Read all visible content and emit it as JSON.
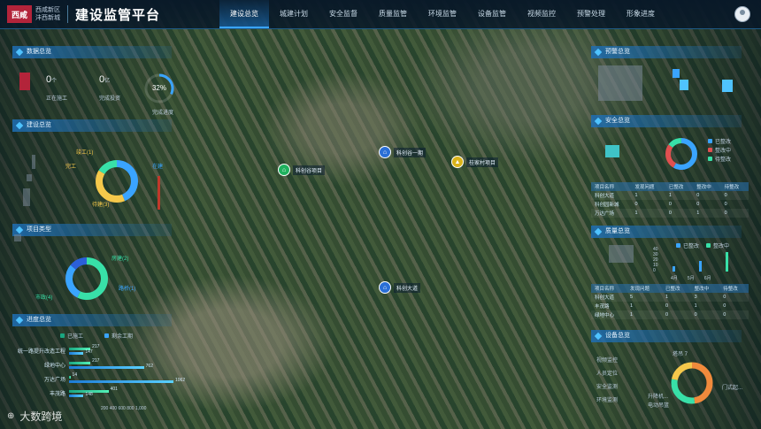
{
  "header": {
    "logo_text": "西咸",
    "org_line1": "西咸新区",
    "org_line2": "沣西新城",
    "title": "建设监管平台",
    "nav": [
      "建设总览",
      "城建计划",
      "安全监督",
      "质量监管",
      "环境监管",
      "设备监管",
      "视频监控",
      "预警处理",
      "形象进度"
    ],
    "active_nav": "建设总览"
  },
  "left": {
    "data_overview": {
      "title": "数据总览",
      "stats": [
        {
          "value": "0",
          "unit": "个",
          "label": "正在施工"
        },
        {
          "value": "0",
          "unit": "亿",
          "label": "完成投资"
        }
      ],
      "percent": "32%",
      "percent_label": "完成进度"
    },
    "build_overview": {
      "title": "建设总览",
      "donut_labels": [
        "竣工(1)",
        "完工",
        "在建",
        "待建(3)"
      ]
    },
    "project_type": {
      "title": "项目类型",
      "donut_labels": [
        "房建(2)",
        "市政(4)",
        "路桥(1)"
      ]
    },
    "progress": {
      "title": "进度总览",
      "legend": [
        "已施工",
        "剩余工期"
      ],
      "rows": [
        {
          "label": "统一路提升改造工程",
          "v1": 217,
          "v2": 147
        },
        {
          "label": "绿地中心",
          "v1": 217,
          "v2": 762
        },
        {
          "label": "万达广场",
          "v1": 14,
          "v2": 1062
        },
        {
          "label": "丰茂路",
          "v1": 401,
          "v2": 148
        }
      ],
      "axis": [
        "200",
        "400",
        "600",
        "800",
        "1,000"
      ]
    }
  },
  "right": {
    "top_title": "预警总览",
    "safety": {
      "title": "安全总览",
      "legend": [
        "已整改",
        "整改中",
        "待整改"
      ],
      "table_headers": [
        "项目名称",
        "发现问题",
        "已整改",
        "整改中",
        "待整改"
      ],
      "rows": [
        [
          "科创大道",
          "1",
          "1",
          "0",
          "0"
        ],
        [
          "科创园新城",
          "0",
          "0",
          "0",
          "0"
        ],
        [
          "万达广场",
          "1",
          "0",
          "1",
          "0"
        ]
      ]
    },
    "quality": {
      "title": "质量总览",
      "legend": [
        "已整改",
        "整改中"
      ],
      "y_ticks": [
        "40",
        "30",
        "20",
        "10",
        "0"
      ],
      "x_ticks": [
        "4月",
        "5月",
        "6月"
      ],
      "table_headers": [
        "项目名称",
        "发现问题",
        "已整改",
        "整改中",
        "待整改"
      ],
      "rows": [
        [
          "科创大道",
          "5",
          "1",
          "3",
          "0"
        ],
        [
          "丰茂路",
          "1",
          "0",
          "1",
          "0"
        ],
        [
          "绿地中心",
          "1",
          "0",
          "0",
          "0"
        ]
      ]
    },
    "equipment": {
      "title": "设备总览",
      "items": [
        "视频监控",
        "人员定位",
        "安全监测",
        "环境监测"
      ],
      "donut_labels": [
        "塔吊 7",
        "门式起...",
        "升降机...",
        "电动吊篮"
      ]
    }
  },
  "map_markers": [
    {
      "label": "科创谷项目",
      "color": "#1fb15e",
      "icon": "building-icon"
    },
    {
      "label": "科创谷一期",
      "color": "#2a6fd6",
      "icon": "building-icon"
    },
    {
      "label": "桂家村项目",
      "color": "#d9b31a",
      "icon": "construction-icon"
    },
    {
      "label": "科创大道",
      "color": "#2a6fd6",
      "icon": "building-icon"
    }
  ],
  "watermark": "大数跨境",
  "colors": {
    "accent": "#3aa4ff",
    "donut_blue": "#3aa4ff",
    "donut_yellow": "#f5c84b",
    "donut_green": "#38e0a8",
    "donut_orange": "#f08a3c",
    "donut_red": "#e05050"
  }
}
